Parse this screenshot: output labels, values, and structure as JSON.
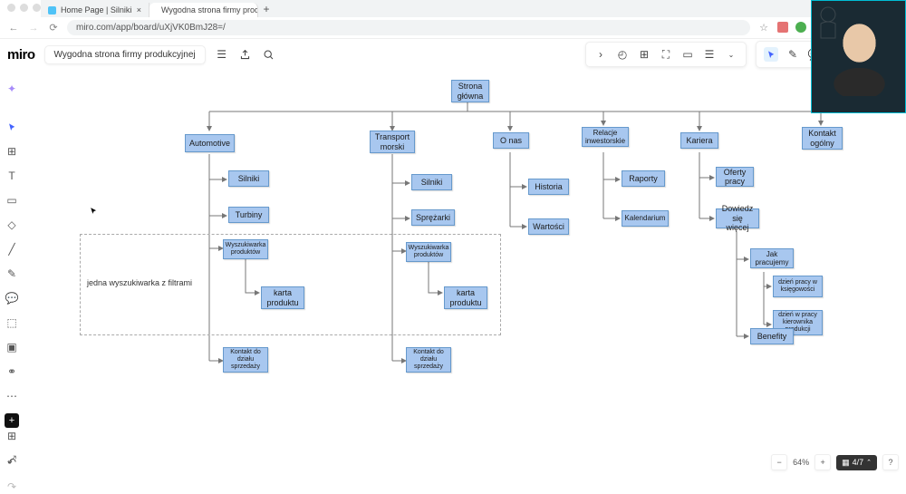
{
  "browser": {
    "tabs": [
      {
        "title": "Home Page | Silniki",
        "active": false
      },
      {
        "title": "Wygodna strona firmy produ…",
        "active": true
      }
    ],
    "url": "miro.com/app/board/uXjVK0BmJ28=/"
  },
  "miro": {
    "logo": "miro",
    "board_name": "Wygodna strona firmy produkcyjnej"
  },
  "zoom": {
    "percent": "64%",
    "pages": "4/7"
  },
  "diagram": {
    "root": "Strona główna",
    "dashed_label": "jedna wyszukiwarka z filtrami",
    "branches": {
      "automotive": {
        "title": "Automotive",
        "items": [
          "Silniki",
          "Turbiny",
          "Wyszukiwarka produktów",
          "karta produktu",
          "Kontakt do działu sprzedaży"
        ]
      },
      "transport": {
        "title": "Transport morski",
        "items": [
          "Silniki",
          "Sprężarki",
          "Wyszukiwarka produktów",
          "karta produktu",
          "Kontakt do działu sprzedaży"
        ]
      },
      "onas": {
        "title": "O nas",
        "items": [
          "Historia",
          "Wartości"
        ]
      },
      "relacje": {
        "title": "Relacje inwestorskie",
        "items": [
          "Raporty",
          "Kalendarium"
        ]
      },
      "kariera": {
        "title": "Kariera",
        "items": [
          "Oferty pracy",
          "Dowiedz się więcej",
          "Jak pracujemy",
          "dzień pracy w księgowości",
          "dzień w pracy kierownika produkcji",
          "Benefity"
        ]
      },
      "kontakt": {
        "title": "Kontakt ogólny"
      }
    }
  }
}
